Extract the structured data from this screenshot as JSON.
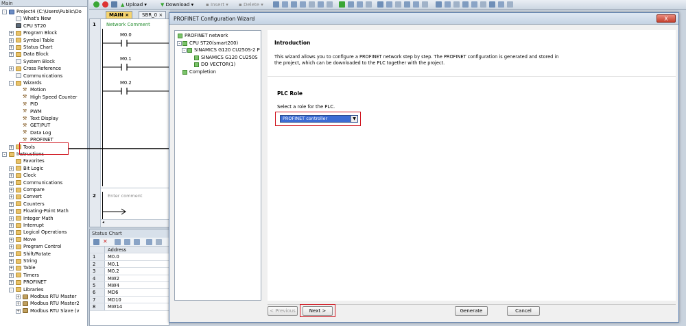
{
  "left_panel": {
    "title": "Main",
    "items": [
      {
        "label": "Project4 (C:\\Users\\Public\\Do",
        "level": 0,
        "exp": "-",
        "icon": "proj"
      },
      {
        "label": "What's New",
        "level": 1,
        "exp": "",
        "icon": "doc"
      },
      {
        "label": "CPU ST20",
        "level": 1,
        "exp": "",
        "icon": "cpu"
      },
      {
        "label": "Program Block",
        "level": 1,
        "exp": "+",
        "icon": "fold"
      },
      {
        "label": "Symbol Table",
        "level": 1,
        "exp": "+",
        "icon": "fold"
      },
      {
        "label": "Status Chart",
        "level": 1,
        "exp": "+",
        "icon": "fold"
      },
      {
        "label": "Data Block",
        "level": 1,
        "exp": "+",
        "icon": "fold"
      },
      {
        "label": "System Block",
        "level": 1,
        "exp": "",
        "icon": "doc"
      },
      {
        "label": "Cross Reference",
        "level": 1,
        "exp": "+",
        "icon": "fold"
      },
      {
        "label": "Communications",
        "level": 1,
        "exp": "",
        "icon": "doc"
      },
      {
        "label": "Wizards",
        "level": 1,
        "exp": "-",
        "icon": "fold"
      },
      {
        "label": "Motion",
        "level": 2,
        "exp": "",
        "icon": "wiz"
      },
      {
        "label": "High Speed Counter",
        "level": 2,
        "exp": "",
        "icon": "wiz"
      },
      {
        "label": "PID",
        "level": 2,
        "exp": "",
        "icon": "wiz"
      },
      {
        "label": "PWM",
        "level": 2,
        "exp": "",
        "icon": "wiz"
      },
      {
        "label": "Text Display",
        "level": 2,
        "exp": "",
        "icon": "wiz"
      },
      {
        "label": "GET/PUT",
        "level": 2,
        "exp": "",
        "icon": "wiz"
      },
      {
        "label": "Data Log",
        "level": 2,
        "exp": "",
        "icon": "wiz"
      },
      {
        "label": "PROFINET",
        "level": 2,
        "exp": "",
        "icon": "wiz"
      },
      {
        "label": "Tools",
        "level": 1,
        "exp": "+",
        "icon": "fold"
      },
      {
        "label": "Instructions",
        "level": 0,
        "exp": "-",
        "icon": "fold"
      },
      {
        "label": "Favorites",
        "level": 1,
        "exp": "",
        "icon": "fold"
      },
      {
        "label": "Bit Logic",
        "level": 1,
        "exp": "+",
        "icon": "fold"
      },
      {
        "label": "Clock",
        "level": 1,
        "exp": "+",
        "icon": "fold"
      },
      {
        "label": "Communications",
        "level": 1,
        "exp": "+",
        "icon": "fold"
      },
      {
        "label": "Compare",
        "level": 1,
        "exp": "+",
        "icon": "fold"
      },
      {
        "label": "Convert",
        "level": 1,
        "exp": "+",
        "icon": "fold"
      },
      {
        "label": "Counters",
        "level": 1,
        "exp": "+",
        "icon": "fold"
      },
      {
        "label": "Floating-Point Math",
        "level": 1,
        "exp": "+",
        "icon": "fold"
      },
      {
        "label": "Integer Math",
        "level": 1,
        "exp": "+",
        "icon": "fold"
      },
      {
        "label": "Interrupt",
        "level": 1,
        "exp": "+",
        "icon": "fold"
      },
      {
        "label": "Logical Operations",
        "level": 1,
        "exp": "+",
        "icon": "fold"
      },
      {
        "label": "Move",
        "level": 1,
        "exp": "+",
        "icon": "fold"
      },
      {
        "label": "Program Control",
        "level": 1,
        "exp": "+",
        "icon": "fold"
      },
      {
        "label": "Shift/Rotate",
        "level": 1,
        "exp": "+",
        "icon": "fold"
      },
      {
        "label": "String",
        "level": 1,
        "exp": "+",
        "icon": "fold"
      },
      {
        "label": "Table",
        "level": 1,
        "exp": "+",
        "icon": "fold"
      },
      {
        "label": "Timers",
        "level": 1,
        "exp": "+",
        "icon": "fold"
      },
      {
        "label": "PROFINET",
        "level": 1,
        "exp": "+",
        "icon": "fold"
      },
      {
        "label": "Libraries",
        "level": 1,
        "exp": "-",
        "icon": "fold"
      },
      {
        "label": "Modbus RTU Master",
        "level": 2,
        "exp": "+",
        "icon": "lib"
      },
      {
        "label": "Modbus RTU Master2",
        "level": 2,
        "exp": "+",
        "icon": "lib"
      },
      {
        "label": "Modbus RTU Slave (v",
        "level": 2,
        "exp": "+",
        "icon": "lib"
      }
    ]
  },
  "toolbar": {
    "upload_label": "Upload",
    "download_label": "Download",
    "insert_label": "Insert",
    "delete_label": "Delete"
  },
  "tabs": [
    {
      "label": "MAIN",
      "close": "×"
    },
    {
      "label": "SBR_0",
      "close": "×"
    }
  ],
  "editor": {
    "network1_no": "1",
    "network1_comment": "Network Comment",
    "contacts": [
      "M0.0",
      "M0.1",
      "M0.2"
    ],
    "network2_no": "2",
    "network2_placeholder": "Enter comment"
  },
  "status_chart": {
    "title": "Status Chart",
    "header": "Address",
    "rows": [
      {
        "n": "1",
        "addr": "M0.0"
      },
      {
        "n": "2",
        "addr": "M0.1"
      },
      {
        "n": "3",
        "addr": "M0.2"
      },
      {
        "n": "4",
        "addr": "MW2"
      },
      {
        "n": "5",
        "addr": "MW4"
      },
      {
        "n": "6",
        "addr": "MD6"
      },
      {
        "n": "7",
        "addr": "MD10"
      },
      {
        "n": "8",
        "addr": "MW14"
      }
    ]
  },
  "dialog": {
    "title": "PROFINET Configuration Wizard",
    "close_glyph": "X",
    "tree": [
      {
        "label": "PROFINET network",
        "x": 4
      },
      {
        "label": "CPU ST20(smart200)",
        "x": 11
      },
      {
        "label": "SINAMICS G120 CU250S-2 P",
        "x": 18
      },
      {
        "label": "SINAMICS G120 CU250S",
        "x": 28
      },
      {
        "label": "DO VECTOR(1)",
        "x": 28
      },
      {
        "label": "Completion",
        "x": 11
      }
    ],
    "intro_heading": "Introduction",
    "intro_text": "This wizard allows you to configure a PROFINET network step by step. The PROFINET configuration is generated and stored in the project, which can be downloaded to the PLC together with the project.",
    "plc_role_heading": "PLC Role",
    "plc_role_prompt": "Select a role for the PLC.",
    "plc_role_value": "PROFINET controller",
    "buttons": {
      "previous": "< Previous",
      "next": "Next >",
      "generate": "Generate",
      "cancel": "Cancel"
    }
  },
  "colors": {
    "highlight_red": "#d0141e",
    "network_comment_green": "#1f8a2a",
    "select_blue": "#3c6cd4"
  }
}
